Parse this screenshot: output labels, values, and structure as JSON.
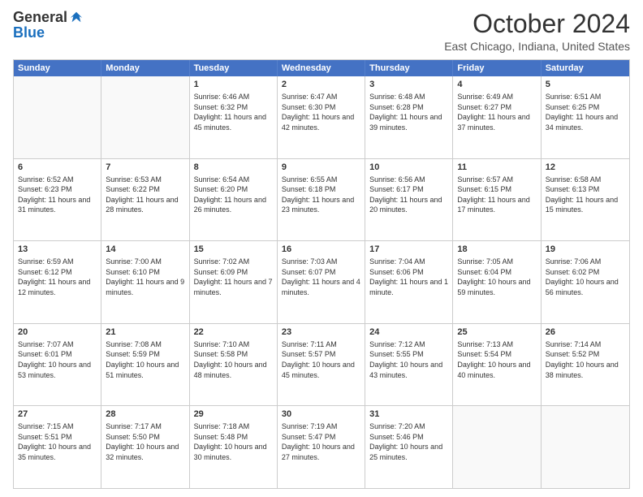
{
  "logo": {
    "general": "General",
    "blue": "Blue"
  },
  "header": {
    "title": "October 2024",
    "subtitle": "East Chicago, Indiana, United States"
  },
  "days": [
    "Sunday",
    "Monday",
    "Tuesday",
    "Wednesday",
    "Thursday",
    "Friday",
    "Saturday"
  ],
  "rows": [
    [
      {
        "day": "",
        "info": "",
        "empty": true
      },
      {
        "day": "",
        "info": "",
        "empty": true
      },
      {
        "day": "1",
        "info": "Sunrise: 6:46 AM\nSunset: 6:32 PM\nDaylight: 11 hours and 45 minutes."
      },
      {
        "day": "2",
        "info": "Sunrise: 6:47 AM\nSunset: 6:30 PM\nDaylight: 11 hours and 42 minutes."
      },
      {
        "day": "3",
        "info": "Sunrise: 6:48 AM\nSunset: 6:28 PM\nDaylight: 11 hours and 39 minutes."
      },
      {
        "day": "4",
        "info": "Sunrise: 6:49 AM\nSunset: 6:27 PM\nDaylight: 11 hours and 37 minutes."
      },
      {
        "day": "5",
        "info": "Sunrise: 6:51 AM\nSunset: 6:25 PM\nDaylight: 11 hours and 34 minutes."
      }
    ],
    [
      {
        "day": "6",
        "info": "Sunrise: 6:52 AM\nSunset: 6:23 PM\nDaylight: 11 hours and 31 minutes."
      },
      {
        "day": "7",
        "info": "Sunrise: 6:53 AM\nSunset: 6:22 PM\nDaylight: 11 hours and 28 minutes."
      },
      {
        "day": "8",
        "info": "Sunrise: 6:54 AM\nSunset: 6:20 PM\nDaylight: 11 hours and 26 minutes."
      },
      {
        "day": "9",
        "info": "Sunrise: 6:55 AM\nSunset: 6:18 PM\nDaylight: 11 hours and 23 minutes."
      },
      {
        "day": "10",
        "info": "Sunrise: 6:56 AM\nSunset: 6:17 PM\nDaylight: 11 hours and 20 minutes."
      },
      {
        "day": "11",
        "info": "Sunrise: 6:57 AM\nSunset: 6:15 PM\nDaylight: 11 hours and 17 minutes."
      },
      {
        "day": "12",
        "info": "Sunrise: 6:58 AM\nSunset: 6:13 PM\nDaylight: 11 hours and 15 minutes."
      }
    ],
    [
      {
        "day": "13",
        "info": "Sunrise: 6:59 AM\nSunset: 6:12 PM\nDaylight: 11 hours and 12 minutes."
      },
      {
        "day": "14",
        "info": "Sunrise: 7:00 AM\nSunset: 6:10 PM\nDaylight: 11 hours and 9 minutes."
      },
      {
        "day": "15",
        "info": "Sunrise: 7:02 AM\nSunset: 6:09 PM\nDaylight: 11 hours and 7 minutes."
      },
      {
        "day": "16",
        "info": "Sunrise: 7:03 AM\nSunset: 6:07 PM\nDaylight: 11 hours and 4 minutes."
      },
      {
        "day": "17",
        "info": "Sunrise: 7:04 AM\nSunset: 6:06 PM\nDaylight: 11 hours and 1 minute."
      },
      {
        "day": "18",
        "info": "Sunrise: 7:05 AM\nSunset: 6:04 PM\nDaylight: 10 hours and 59 minutes."
      },
      {
        "day": "19",
        "info": "Sunrise: 7:06 AM\nSunset: 6:02 PM\nDaylight: 10 hours and 56 minutes."
      }
    ],
    [
      {
        "day": "20",
        "info": "Sunrise: 7:07 AM\nSunset: 6:01 PM\nDaylight: 10 hours and 53 minutes."
      },
      {
        "day": "21",
        "info": "Sunrise: 7:08 AM\nSunset: 5:59 PM\nDaylight: 10 hours and 51 minutes."
      },
      {
        "day": "22",
        "info": "Sunrise: 7:10 AM\nSunset: 5:58 PM\nDaylight: 10 hours and 48 minutes."
      },
      {
        "day": "23",
        "info": "Sunrise: 7:11 AM\nSunset: 5:57 PM\nDaylight: 10 hours and 45 minutes."
      },
      {
        "day": "24",
        "info": "Sunrise: 7:12 AM\nSunset: 5:55 PM\nDaylight: 10 hours and 43 minutes."
      },
      {
        "day": "25",
        "info": "Sunrise: 7:13 AM\nSunset: 5:54 PM\nDaylight: 10 hours and 40 minutes."
      },
      {
        "day": "26",
        "info": "Sunrise: 7:14 AM\nSunset: 5:52 PM\nDaylight: 10 hours and 38 minutes."
      }
    ],
    [
      {
        "day": "27",
        "info": "Sunrise: 7:15 AM\nSunset: 5:51 PM\nDaylight: 10 hours and 35 minutes."
      },
      {
        "day": "28",
        "info": "Sunrise: 7:17 AM\nSunset: 5:50 PM\nDaylight: 10 hours and 32 minutes."
      },
      {
        "day": "29",
        "info": "Sunrise: 7:18 AM\nSunset: 5:48 PM\nDaylight: 10 hours and 30 minutes."
      },
      {
        "day": "30",
        "info": "Sunrise: 7:19 AM\nSunset: 5:47 PM\nDaylight: 10 hours and 27 minutes."
      },
      {
        "day": "31",
        "info": "Sunrise: 7:20 AM\nSunset: 5:46 PM\nDaylight: 10 hours and 25 minutes."
      },
      {
        "day": "",
        "info": "",
        "empty": true
      },
      {
        "day": "",
        "info": "",
        "empty": true
      }
    ]
  ]
}
